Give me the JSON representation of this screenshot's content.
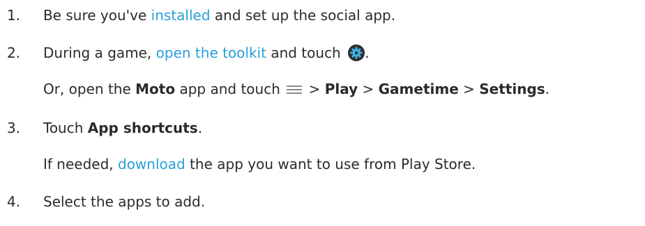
{
  "steps": [
    {
      "number": "1.",
      "pre": "Be sure you've ",
      "link": "installed",
      "post": " and set up the social app."
    },
    {
      "number": "2.",
      "pre": "During a game, ",
      "link": "open the toolkit",
      "post": " and touch ",
      "end": ".",
      "icon": "gear-icon",
      "sub": {
        "pre": "Or, open the ",
        "bold1": "Moto",
        "mid": " app and touch ",
        "icon": "menu-icon",
        "sep1": " > ",
        "bold2": "Play",
        "sep2": " > ",
        "bold3": "Gametime",
        "sep3": " > ",
        "bold4": "Settings",
        "end": "."
      }
    },
    {
      "number": "3.",
      "pre": "Touch ",
      "bold": "App shortcuts",
      "end": ".",
      "sub": {
        "pre": "If needed, ",
        "link": "download",
        "post": " the app you want to use from Play Store."
      }
    },
    {
      "number": "4.",
      "text": "Select the apps to add."
    }
  ],
  "colors": {
    "link": "#2a9fd8",
    "gear_accent": "#3db4e8"
  }
}
